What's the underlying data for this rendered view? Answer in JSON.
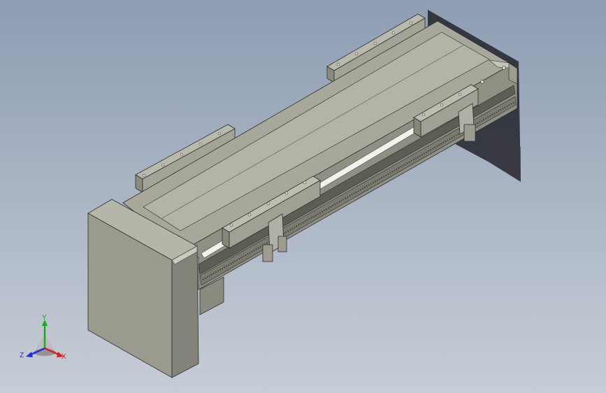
{
  "viewport": {
    "background_top": "#8e9db3",
    "background_bottom": "#c7cdd6",
    "model": {
      "body_color": "#9d9d8f",
      "shadow_color": "#1f1f26",
      "rod_color": "#f3f3ee"
    }
  },
  "triad": {
    "x_label": "X",
    "y_label": "Y",
    "z_label": "Z",
    "x_color": "#d81e1e",
    "y_color": "#1ea81e",
    "z_color": "#1e2fd8"
  }
}
